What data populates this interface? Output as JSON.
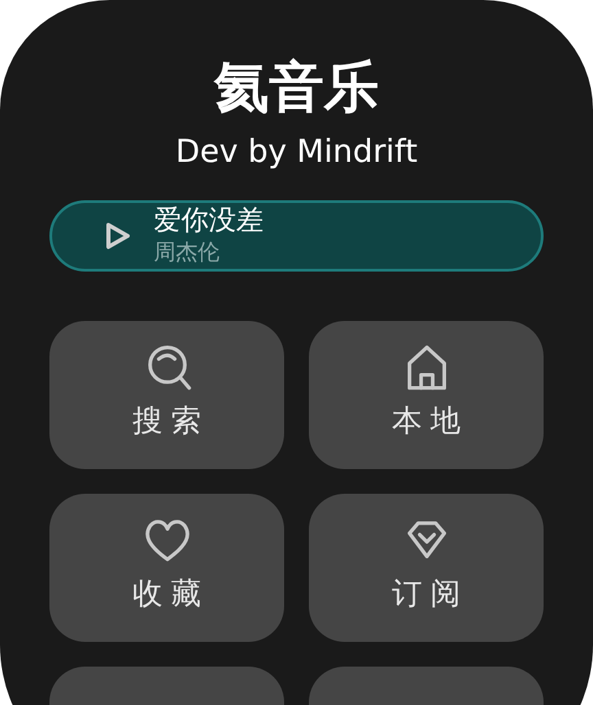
{
  "app": {
    "title": "氦音乐",
    "subtitle": "Dev by Mindrift"
  },
  "now_playing": {
    "song": "爱你没差",
    "artist": "周杰伦"
  },
  "tiles": [
    {
      "kind": "search",
      "label": "搜 索"
    },
    {
      "kind": "home",
      "label": "本 地"
    },
    {
      "kind": "heart",
      "label": "收 藏"
    },
    {
      "kind": "diamond",
      "label": "订 阅"
    }
  ]
}
